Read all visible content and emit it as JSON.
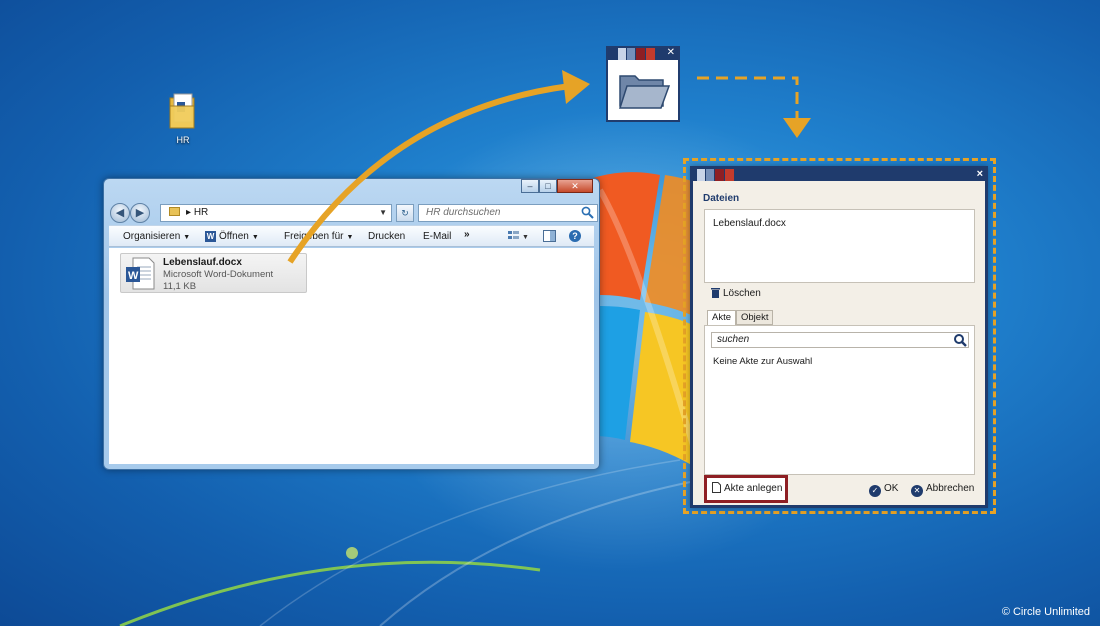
{
  "desktop": {
    "icon_label": "HR",
    "copyright": "© Circle Unlimited"
  },
  "explorer": {
    "address": "HR",
    "search_placeholder": "HR durchsuchen",
    "toolbar": {
      "organize": "Organisieren",
      "open": "Öffnen",
      "share": "Freigeben für",
      "print": "Drucken",
      "email": "E-Mail",
      "more": "»"
    },
    "file": {
      "name": "Lebenslauf.docx",
      "type": "Microsoft Word-Dokument",
      "size": "11,1 KB"
    }
  },
  "dialog": {
    "close": "×",
    "section_title": "Dateien",
    "files": [
      "Lebenslauf.docx"
    ],
    "delete_label": "Löschen",
    "tabs": [
      "Akte",
      "Objekt"
    ],
    "search_value": "suchen",
    "empty_message": "Keine Akte zur Auswahl",
    "create_label": "Akte anlegen",
    "ok_label": "OK",
    "cancel_label": "Abbrechen"
  },
  "colors": {
    "accent_navy": "#1f3b6d",
    "accent_red": "#8e1f24",
    "arrow_orange": "#e6a326"
  }
}
